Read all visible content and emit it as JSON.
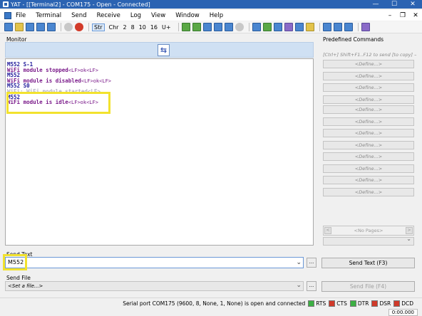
{
  "window": {
    "title": "YAT - [[Terminal2] - COM175 - Open - Connected]"
  },
  "menu": [
    "File",
    "Terminal",
    "Send",
    "Receive",
    "Log",
    "View",
    "Window",
    "Help"
  ],
  "toolbar": {
    "radix": [
      "Str",
      "Chr",
      "2",
      "8",
      "10",
      "16",
      "U+"
    ],
    "active_radix": "Str"
  },
  "monitor": {
    "label": "Monitor",
    "lines": [
      {
        "text": "M552 S-1",
        "style": "tx"
      },
      {
        "text": "WiFi module stopped",
        "suffix": "<LF>ok<LF>",
        "style": "rx"
      },
      {
        "text": "M552",
        "style": "tx"
      },
      {
        "text": "WiFi module is disabled",
        "suffix": "<LF>ok<LF>",
        "style": "rx"
      },
      {
        "text": "M552 S0",
        "style": "tx"
      },
      {
        "text": "WiFi: WiFi module started<LF>",
        "style": "partial"
      },
      {
        "text": "M552",
        "style": "tx"
      },
      {
        "text": "WiFi module is idle",
        "suffix": "<LF>ok<LF>",
        "style": "rx"
      }
    ]
  },
  "predefined": {
    "label": "Predefined Commands",
    "hint": "[Ctrl+] Shift+F1..F12 to send [to copy] –",
    "define_label": "<Define...>",
    "no_pages": "<No Pages>"
  },
  "send_text": {
    "label": "Send Text",
    "value": "M552",
    "button": "Send Text (F3)"
  },
  "send_file": {
    "label": "Send File",
    "placeholder": "<Set a file...>",
    "button": "Send File (F4)"
  },
  "status": {
    "text": "Serial port COM175 (9600, 8, None, 1, None) is open and connected",
    "signals": [
      {
        "name": "RTS",
        "on": true
      },
      {
        "name": "CTS",
        "on": false
      },
      {
        "name": "DTR",
        "on": true
      },
      {
        "name": "DSR",
        "on": false
      },
      {
        "name": "DCD",
        "on": false
      }
    ],
    "time": "0:00.000"
  },
  "colors": {
    "tx": "#1f1a9a",
    "rx": "#7a1a8a",
    "highlight": "#f2e22e",
    "led_on": "#3cb043",
    "led_off": "#d03a2a"
  }
}
